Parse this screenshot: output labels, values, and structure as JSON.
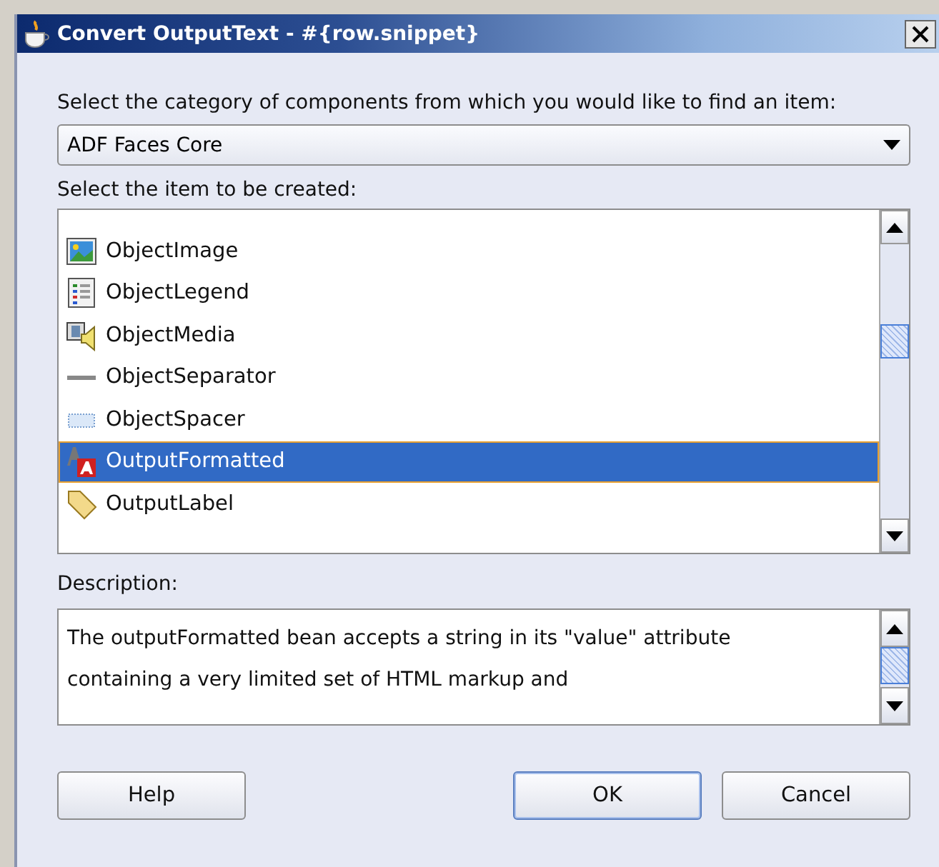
{
  "window": {
    "title": "Convert OutputText - #{row.snippet}"
  },
  "category": {
    "label": "Select the category of components from which you would like to find an item:",
    "value": "ADF Faces Core"
  },
  "items_label": "Select the item to be created:",
  "items": [
    {
      "label": "ObjectImage",
      "kind": "image",
      "selected": false
    },
    {
      "label": "ObjectLegend",
      "kind": "legend",
      "selected": false
    },
    {
      "label": "ObjectMedia",
      "kind": "media",
      "selected": false
    },
    {
      "label": "ObjectSeparator",
      "kind": "separator",
      "selected": false
    },
    {
      "label": "ObjectSpacer",
      "kind": "spacer",
      "selected": false
    },
    {
      "label": "OutputFormatted",
      "kind": "formatted",
      "selected": true
    },
    {
      "label": "OutputLabel",
      "kind": "tag",
      "selected": false
    }
  ],
  "description": {
    "label": "Description:",
    "text": "The outputFormatted bean accepts a string in its \"value\" attribute containing a very limited set of HTML markup and"
  },
  "buttons": [
    {
      "label": "Help",
      "kind": "help"
    },
    {
      "label": "OK",
      "kind": "default"
    },
    {
      "label": "Cancel",
      "kind": "cancel"
    }
  ]
}
